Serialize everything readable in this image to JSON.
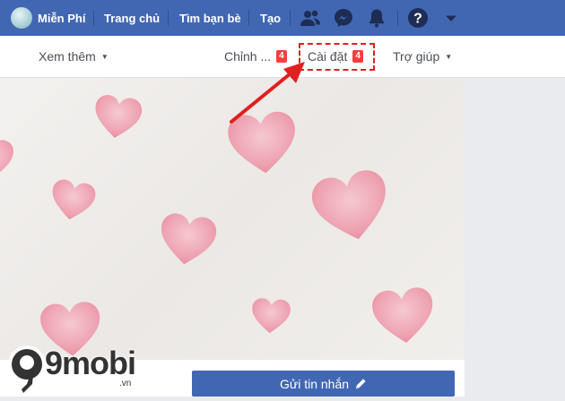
{
  "topbar": {
    "profile_name": "Miễn Phí",
    "home_label": "Trang chủ",
    "find_friends_label": "Tìm bạn bè",
    "create_label": "Tạo",
    "color": "#4267b2"
  },
  "subnav": {
    "more_label": "Xem thêm",
    "edit_label": "Chỉnh ...",
    "edit_badge": "4",
    "settings_label": "Cài đặt",
    "settings_badge": "4",
    "help_label": "Trợ giúp"
  },
  "actions": {
    "send_message_label": "Gửi tin nhắn"
  },
  "watermark": {
    "logo_text": "9mobi",
    "logo_suffix": ".vn"
  },
  "annotation": {
    "highlight_color": "#e0201e"
  }
}
